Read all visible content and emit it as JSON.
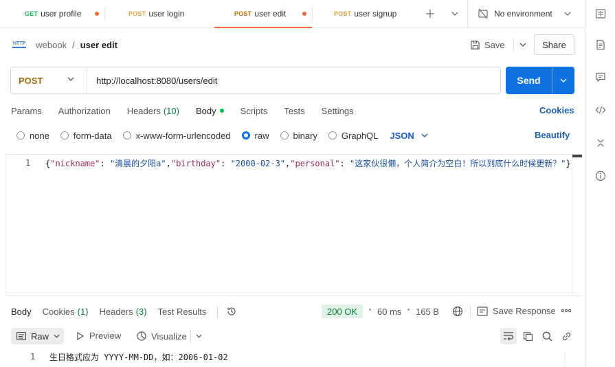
{
  "tabs": [
    {
      "method": "GET",
      "name": "user profile",
      "unsaved": true,
      "active": false
    },
    {
      "method": "POST",
      "name": "user login",
      "unsaved": false,
      "active": false
    },
    {
      "method": "POST",
      "name": "user edit",
      "unsaved": true,
      "active": true
    },
    {
      "method": "POST",
      "name": "user signup",
      "unsaved": false,
      "active": false
    }
  ],
  "environment": {
    "label": "No environment"
  },
  "breadcrumb": {
    "badge": "HTTP",
    "collection": "webook",
    "separator": "/",
    "request": "user edit"
  },
  "actions": {
    "save_label": "Save",
    "share_label": "Share"
  },
  "request": {
    "method": "POST",
    "url": "http://localhost:8080/users/edit",
    "send_label": "Send"
  },
  "request_tabs": [
    {
      "label": "Params"
    },
    {
      "label": "Authorization"
    },
    {
      "label": "Headers",
      "count": "(10)"
    },
    {
      "label": "Body",
      "active": true
    },
    {
      "label": "Scripts"
    },
    {
      "label": "Tests"
    },
    {
      "label": "Settings"
    }
  ],
  "cookies_label": "Cookies",
  "body_types": [
    {
      "label": "none",
      "selected": false
    },
    {
      "label": "form-data",
      "selected": false
    },
    {
      "label": "x-www-form-urlencoded",
      "selected": false
    },
    {
      "label": "raw",
      "selected": true
    },
    {
      "label": "binary",
      "selected": false
    },
    {
      "label": "GraphQL",
      "selected": false
    }
  ],
  "body_format": "JSON",
  "beautify_label": "Beautify",
  "editor": {
    "line_number": "1",
    "tokens": [
      {
        "t": "p",
        "v": "{"
      },
      {
        "t": "k",
        "v": "\"nickname\""
      },
      {
        "t": "p",
        "v": ": "
      },
      {
        "t": "s",
        "v": "\"清晨的夕阳a\""
      },
      {
        "t": "p",
        "v": ","
      },
      {
        "t": "k",
        "v": "\"birthday\""
      },
      {
        "t": "p",
        "v": ": "
      },
      {
        "t": "s",
        "v": "\"2000-02-3\""
      },
      {
        "t": "p",
        "v": ","
      },
      {
        "t": "k",
        "v": "\"personal\""
      },
      {
        "t": "p",
        "v": ": "
      },
      {
        "t": "s",
        "v": "\"这家伙很懒，个人简介为空白！所以到底什么时候更新？\""
      },
      {
        "t": "p",
        "v": "}"
      }
    ]
  },
  "response_tabs": [
    {
      "label": "Body",
      "active": true
    },
    {
      "label": "Cookies",
      "count": "(1)"
    },
    {
      "label": "Headers",
      "count": "(3)"
    },
    {
      "label": "Test Results"
    }
  ],
  "response": {
    "status": "200 OK",
    "time": "60 ms",
    "size": "165 B",
    "save_label": "Save Response",
    "view_mode": "Raw",
    "preview_label": "Preview",
    "visualize_label": "Visualize",
    "line_number": "1",
    "body_text": "生日格式应为 YYYY-MM-DD，如：2006-01-02"
  },
  "colors": {
    "accent": "#0f72e0",
    "active_tab": "#f26b3a",
    "status_ok": "#0a7d3b"
  }
}
